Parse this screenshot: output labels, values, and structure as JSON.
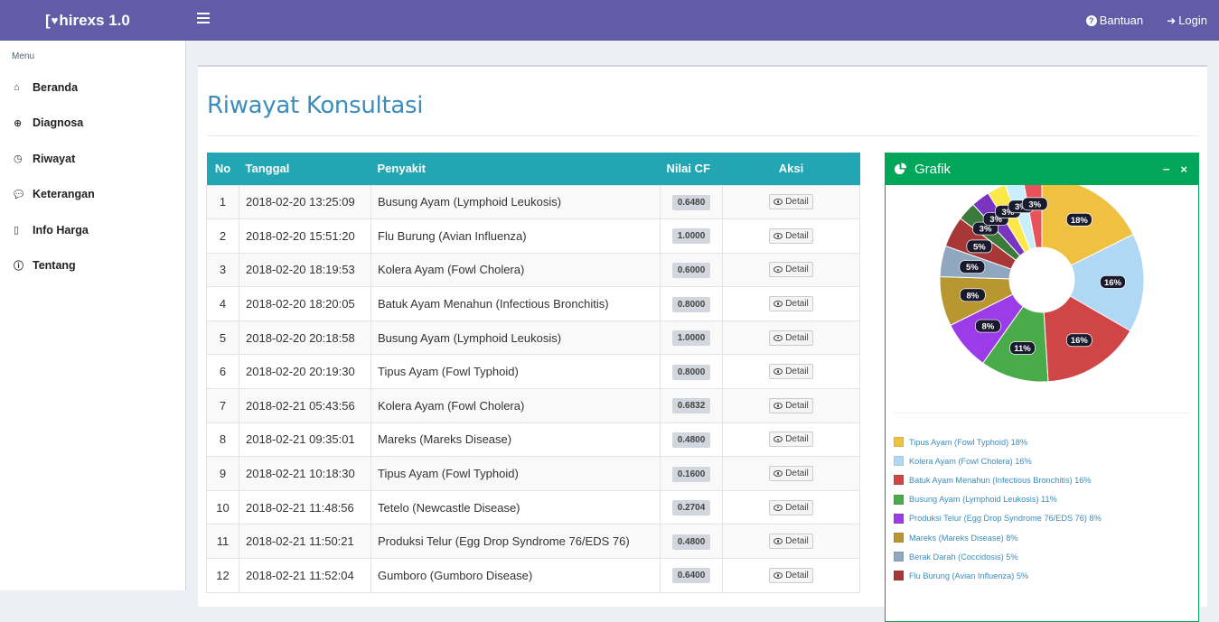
{
  "app": {
    "brand": "hirexs 1.0",
    "brand_prefix": "["
  },
  "top": {
    "help_label": "Bantuan",
    "login_label": "Login"
  },
  "sidebar": {
    "header": "Menu",
    "items": [
      {
        "label": "Beranda",
        "icon": "home-icon",
        "glyph": "⌂"
      },
      {
        "label": "Diagnosa",
        "icon": "search-plus-icon",
        "glyph": "⊕"
      },
      {
        "label": "Riwayat",
        "icon": "clock-icon",
        "glyph": "◷"
      },
      {
        "label": "Keterangan",
        "icon": "comment-icon",
        "glyph": "💬"
      },
      {
        "label": "Info Harga",
        "icon": "bookmark-icon",
        "glyph": "▯"
      },
      {
        "label": "Tentang",
        "icon": "info-icon",
        "glyph": "ⓘ"
      }
    ]
  },
  "main": {
    "title": "Riwayat Konsultasi",
    "table": {
      "headers": [
        "No",
        "Tanggal",
        "Penyakit",
        "Nilai CF",
        "Aksi"
      ],
      "detail_label": "Detail",
      "rows": [
        [
          "1",
          "2018-02-20 13:25:09",
          "Busung Ayam (Lymphoid Leukosis)",
          "0.6480"
        ],
        [
          "2",
          "2018-02-20 15:51:20",
          "Flu Burung (Avian Influenza)",
          "1.0000"
        ],
        [
          "3",
          "2018-02-20 18:19:53",
          "Kolera Ayam (Fowl Cholera)",
          "0.6000"
        ],
        [
          "4",
          "2018-02-20 18:20:05",
          "Batuk Ayam Menahun (Infectious Bronchitis)",
          "0.8000"
        ],
        [
          "5",
          "2018-02-20 20:18:58",
          "Busung Ayam (Lymphoid Leukosis)",
          "1.0000"
        ],
        [
          "6",
          "2018-02-20 20:19:30",
          "Tipus Ayam (Fowl Typhoid)",
          "0.8000"
        ],
        [
          "7",
          "2018-02-21 05:43:56",
          "Kolera Ayam (Fowl Cholera)",
          "0.6832"
        ],
        [
          "8",
          "2018-02-21 09:35:01",
          "Mareks (Mareks Disease)",
          "0.4800"
        ],
        [
          "9",
          "2018-02-21 10:18:30",
          "Tipus Ayam (Fowl Typhoid)",
          "0.1600"
        ],
        [
          "10",
          "2018-02-21 11:48:56",
          "Tetelo (Newcastle Disease)",
          "0.2704"
        ],
        [
          "11",
          "2018-02-21 11:50:21",
          "Produksi Telur (Egg Drop Syndrome 76/EDS 76)",
          "0.4800"
        ],
        [
          "12",
          "2018-02-21 11:52:04",
          "Gumboro (Gumboro Disease)",
          "0.6400"
        ]
      ]
    }
  },
  "grafik": {
    "title": "Grafik",
    "minimize_label": "−",
    "close_label": "×",
    "slice_colors": [
      "#f0c040",
      "#b0d8f5",
      "#d04545",
      "#4aab4a",
      "#9b3ce8",
      "#b89630",
      "#8fa8bf",
      "#a83838",
      "#3c7a3c",
      "#7a35c0",
      "#fde84a",
      "#c9efff",
      "#e8525a"
    ],
    "legend_items": [
      {
        "label": "Tipus Ayam (Fowl Typhoid) 18%",
        "color": "#f0c040"
      },
      {
        "label": "Kolera Ayam (Fowl Cholera) 16%",
        "color": "#b0d8f5"
      },
      {
        "label": "Batuk Ayam Menahun (Infectious Bronchitis) 16%",
        "color": "#d04545"
      },
      {
        "label": "Busung Ayam (Lymphoid Leukosis) 11%",
        "color": "#4aab4a"
      },
      {
        "label": "Produksi Telur (Egg Drop Syndrome 76/EDS 76) 8%",
        "color": "#9b3ce8"
      },
      {
        "label": "Mareks (Mareks Disease) 8%",
        "color": "#b89630"
      },
      {
        "label": "Berak Darah (Coccidosis) 5%",
        "color": "#8fa8bf"
      },
      {
        "label": "Flu Burung (Avian Influenza) 5%",
        "color": "#a83838"
      }
    ],
    "slice_labels": [
      "18%",
      "16%",
      "16%",
      "11%",
      "8%",
      "8%",
      "5%",
      "5%",
      "3%",
      "3%",
      "3%",
      "3%",
      "3%"
    ]
  },
  "chart_data": {
    "type": "pie",
    "categories": [
      "Tipus Ayam (Fowl Typhoid)",
      "Kolera Ayam (Fowl Cholera)",
      "Batuk Ayam Menahun (Infectious Bronchitis)",
      "Busung Ayam (Lymphoid Leukosis)",
      "Produksi Telur (Egg Drop Syndrome 76/EDS 76)",
      "Mareks (Mareks Disease)",
      "Berak Darah (Coccidosis)",
      "Flu Burung (Avian Influenza)",
      "",
      "",
      "",
      "",
      ""
    ],
    "values": [
      18,
      16,
      16,
      11,
      8,
      8,
      5,
      5,
      3,
      3,
      3,
      3,
      3
    ],
    "title": "Grafik"
  }
}
